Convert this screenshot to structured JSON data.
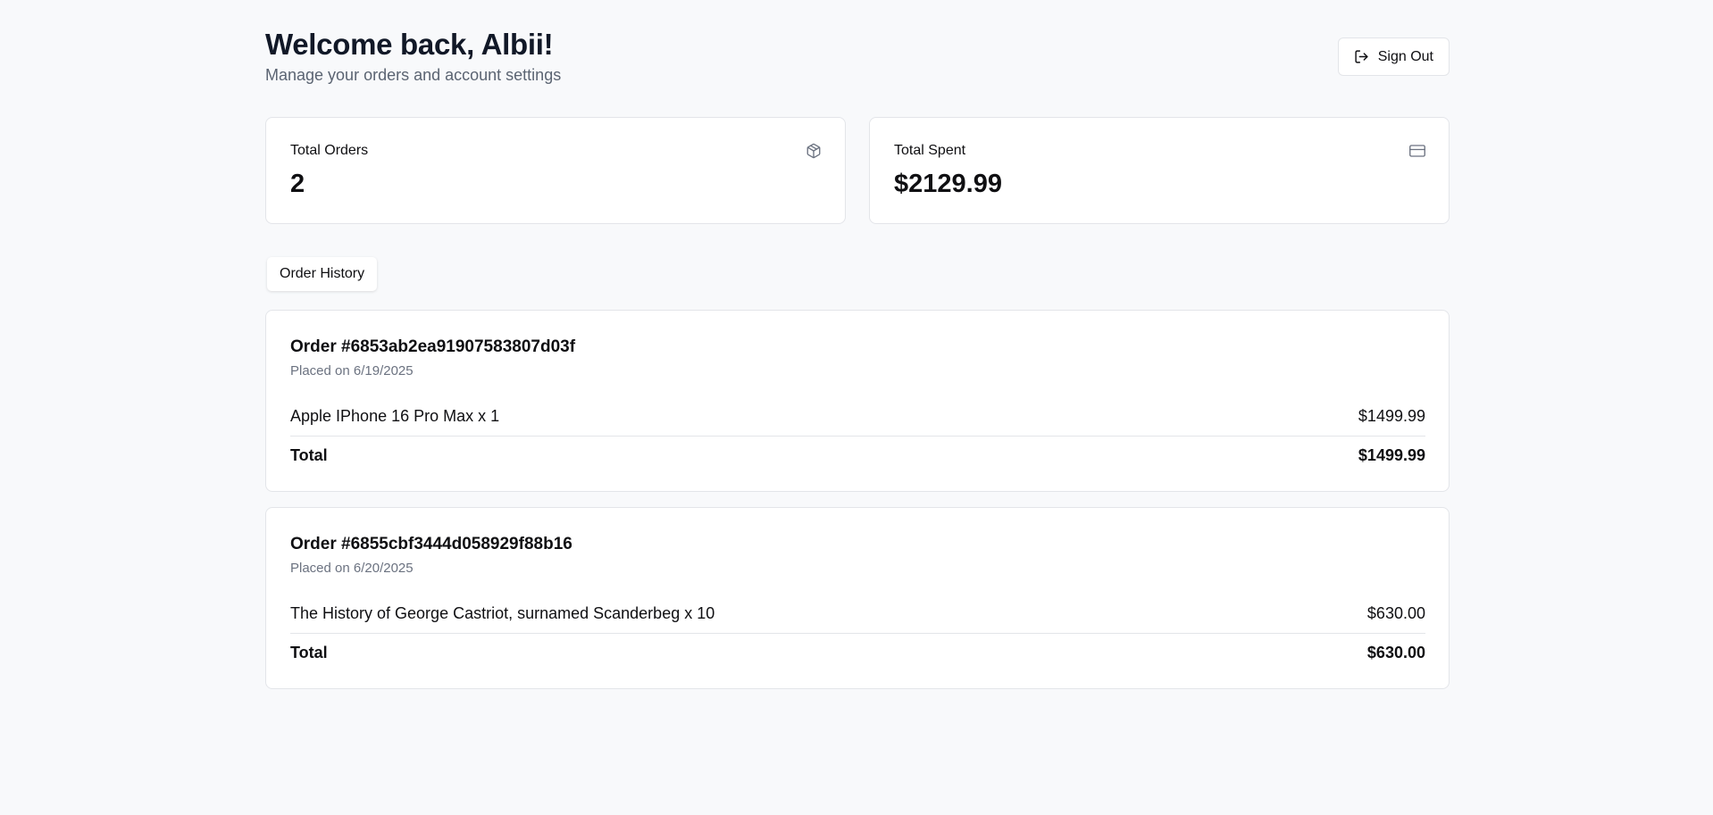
{
  "header": {
    "title": "Welcome back, Albii!",
    "subtitle": "Manage your orders and account settings",
    "sign_out_label": "Sign Out"
  },
  "stats": [
    {
      "label": "Total Orders",
      "value": "2",
      "icon": "package-icon"
    },
    {
      "label": "Total Spent",
      "value": "$2129.99",
      "icon": "credit-card-icon"
    }
  ],
  "tabs": [
    {
      "label": "Order History",
      "active": true
    }
  ],
  "orders": [
    {
      "title": "Order #6853ab2ea91907583807d03f",
      "date": "Placed on 6/19/2025",
      "item": "Apple IPhone 16 Pro Max x 1",
      "item_price": "$1499.99",
      "total_label": "Total",
      "total": "$1499.99"
    },
    {
      "title": "Order #6855cbf3444d058929f88b16",
      "date": "Placed on 6/20/2025",
      "item": "The History of George Castriot, surnamed Scanderbeg x 10",
      "item_price": "$630.00",
      "total_label": "Total",
      "total": "$630.00"
    }
  ],
  "colors": {
    "background": "#f8f9fb",
    "card": "#ffffff",
    "border": "#e3e5e9",
    "text": "#0f0f12",
    "muted": "#6b7280"
  }
}
